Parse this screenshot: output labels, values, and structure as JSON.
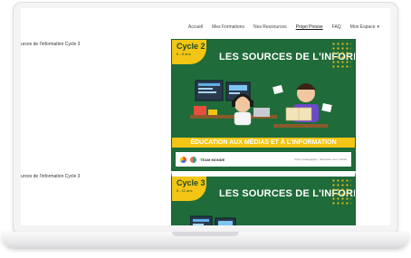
{
  "nav": {
    "items": [
      {
        "label": "Accueil",
        "active": false
      },
      {
        "label": "Mes Formations",
        "active": false
      },
      {
        "label": "Nos Ressources",
        "active": false
      },
      {
        "label": "Projet Presse",
        "active": true
      },
      {
        "label": "FAQ",
        "active": false
      },
      {
        "label": "Mon Espace",
        "active": false,
        "dropdown": true
      }
    ],
    "dropdown_icon": "chevron-down-icon"
  },
  "sections": [
    {
      "title": "urces de l'information Cycle 3",
      "card": {
        "cycle_label": "Cycle 2",
        "cycle_ages": "6 - 8 ans",
        "title": "LES SOURCES DE L'INFORMATION",
        "banner": "ÉDUCATION AUX MÉDIAS ET À L'INFORMATION",
        "footer_team": "TEAM MONDE",
        "footer_note": "Fiche pédagogique · Éducation aux médias"
      }
    },
    {
      "title": "urces de l'information Cycle 3",
      "card": {
        "cycle_label": "Cycle 3",
        "cycle_ages": "8 - 11 ans",
        "title": "LES SOURCES DE L'INFORMATION"
      }
    }
  ],
  "colors": {
    "card_green": "#1f6b3a",
    "accent_yellow": "#f3c514",
    "text_dark": "#333333"
  }
}
